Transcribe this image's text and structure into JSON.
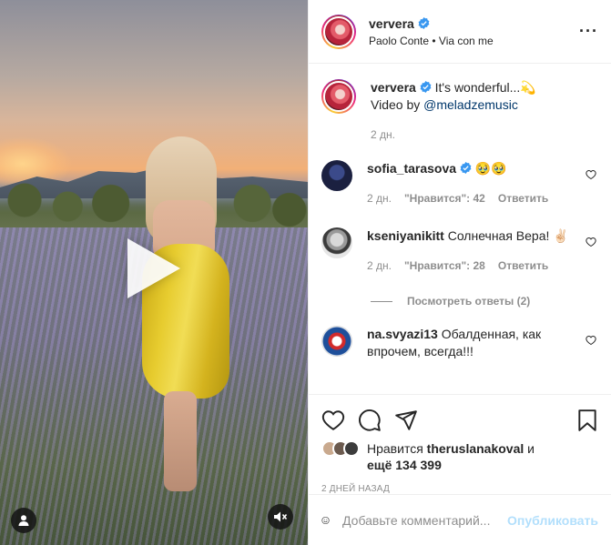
{
  "post": {
    "username": "ververa",
    "music": "Paolo Conte • Via con me"
  },
  "caption": {
    "username": "ververa",
    "text": "It's wonderful...💫",
    "video_by_prefix": "Video by",
    "video_by_mention": "@meladzemusic",
    "time": "2 дн."
  },
  "comments": [
    {
      "username": "sofia_tarasova",
      "text": "🥹🥹",
      "time": "2 дн.",
      "likes": "\"Нравится\": 42",
      "reply": "Ответить"
    },
    {
      "username": "kseniyanikitt",
      "text": "Солнечная Вера! ✌🏻",
      "time": "2 дн.",
      "likes": "\"Нравится\": 28",
      "reply": "Ответить",
      "view_replies": "Посмотреть ответы (2)"
    },
    {
      "username": "na.svyazi13",
      "text": "Обалденная, как впрочем, всегда!!!"
    }
  ],
  "likes": {
    "prefix": "Нравится",
    "user": "theruslanakoval",
    "and": "и",
    "more": "ещё 134 399"
  },
  "posted_date": "2 ДНЕЙ НАЗАД",
  "add_comment": {
    "placeholder": "Добавьте комментарий...",
    "publish": "Опубликовать"
  },
  "icons": {
    "more": "more-options-icon",
    "like": "heart-icon",
    "comment": "comment-icon",
    "share": "share-icon",
    "save": "bookmark-icon",
    "emoji": "emoji-icon",
    "verified": "verified-badge-icon",
    "play": "play-icon",
    "mute": "muted-speaker-icon",
    "tags": "user-tag-icon"
  },
  "colors": {
    "verified": "#3897f0",
    "publish_disabled": "#b2dffc",
    "secondary_text": "#8e8e8e",
    "dress": "#e7cc2f"
  }
}
